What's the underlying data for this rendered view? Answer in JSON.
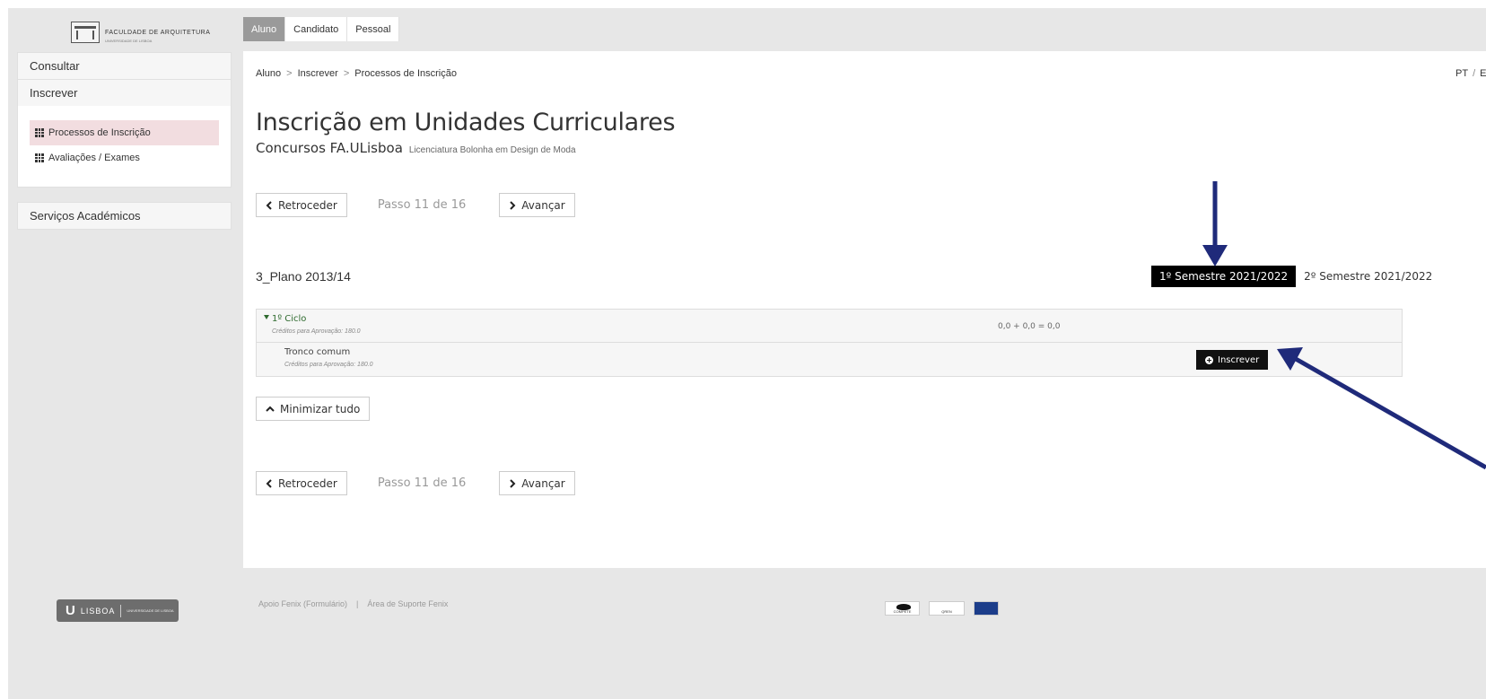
{
  "header": {
    "logo_text": "FACULDADE DE ARQUITETURA",
    "logo_sub": "UNIVERSIDADE DE LISBOA",
    "tabs": [
      {
        "label": "Aluno",
        "active": true
      },
      {
        "label": "Candidato",
        "active": false
      },
      {
        "label": "Pessoal",
        "active": false
      }
    ]
  },
  "sidebar": {
    "consultar": "Consultar",
    "inscrever": "Inscrever",
    "items": [
      {
        "label": "Processos de Inscrição",
        "active": true,
        "icon": "grid-icon"
      },
      {
        "label": "Avaliações / Exames",
        "active": false,
        "icon": "grid-icon"
      }
    ],
    "servicos": "Serviços Académicos"
  },
  "breadcrumb": [
    "Aluno",
    "Inscrever",
    "Processos de Inscrição"
  ],
  "breadcrumb_sep": ">",
  "lang": {
    "pt": "PT",
    "sep": "/",
    "en": "EN"
  },
  "page": {
    "title": "Inscrição em Unidades Curriculares",
    "subtitle": "Concursos FA.ULisboa",
    "degree": "Licenciatura Bolonha em Design de Moda"
  },
  "nav": {
    "back": "Retroceder",
    "step": "Passo 11 de 16",
    "next": "Avançar"
  },
  "plan": {
    "title": "3_Plano 2013/14",
    "semesters": [
      {
        "label": "1º Semestre 2021/2022",
        "active": true
      },
      {
        "label": "2º Semestre 2021/2022",
        "active": false
      }
    ]
  },
  "curriculum": {
    "ciclo": "1º Ciclo",
    "ciclo_credits": "Créditos para Aprovação: 180.0",
    "ciclo_sum": "0,0 + 0,0 = 0,0",
    "group": "Tronco comum",
    "group_credits": "Créditos para Aprovação: 180.0",
    "enroll_button": "Inscrever"
  },
  "minimize": "Minimizar tudo",
  "footer": {
    "ulisboa": "LISBOA",
    "ulisboa_sub": "UNIVERSIDADE DE LISBOA",
    "link1": "Apoio Fenix (Formulário)",
    "link_sep": "|",
    "link2": "Área de Suporte Fenix",
    "logo_compete": "COMPETE",
    "logo_qren": "QREN"
  },
  "colors": {
    "active_tab": "#9a9a9a",
    "sidebar_active": "#f2dde0",
    "semester_active": "#000000",
    "ciclo_green": "#2e6a2e",
    "annotation_arrow": "#1f2a7a"
  }
}
